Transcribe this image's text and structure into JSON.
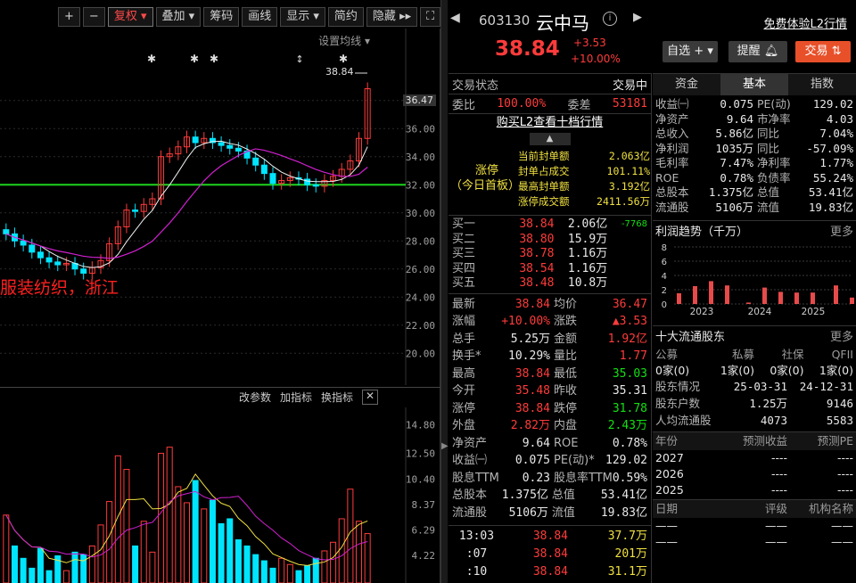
{
  "toolbar": {
    "plus": "+",
    "minus": "−",
    "fuquan": "复权",
    "overlay": "叠加",
    "chips": "筹码",
    "draw": "画线",
    "display": "显示",
    "simple": "简约",
    "hide": "隐藏"
  },
  "chart": {
    "ma_setting": "设置均线",
    "price_label": "38.84",
    "cur_price": "36.47",
    "y_ticks": [
      "38.00",
      "36.00",
      "34.00",
      "32.00",
      "30.00",
      "28.00",
      "26.00",
      "24.00",
      "22.00",
      "20.00"
    ],
    "concept": "服装纺织，浙江",
    "vol_tools": [
      "改参数",
      "加指标",
      "换指标"
    ],
    "vol_ticks": [
      "14.80",
      "12.50",
      "10.40",
      "8.37",
      "6.29",
      "4.22"
    ]
  },
  "chart_data": {
    "type": "candlestick",
    "reference_line": 32.0,
    "last_close": 38.84,
    "y_range": [
      19,
      39
    ],
    "series": [
      {
        "name": "close",
        "values": [
          28.5,
          28.0,
          27.7,
          27.2,
          26.8,
          26.5,
          26.3,
          26.4,
          26.0,
          25.7,
          26.1,
          26.6,
          27.8,
          29.0,
          30.2,
          30.1,
          30.6,
          31.0,
          34.0,
          34.2,
          34.7,
          35.4,
          35.0,
          35.3,
          35.0,
          34.8,
          34.6,
          34.4,
          33.9,
          33.4,
          32.8,
          32.1,
          32.3,
          32.5,
          32.4,
          32.0,
          31.9,
          32.3,
          32.6,
          33.1,
          33.7,
          35.3,
          38.84
        ]
      }
    ]
  },
  "stock": {
    "code": "603130",
    "name": "云中马",
    "price": "38.84",
    "change": "+3.53",
    "pct": "+10.00%",
    "free_l2": "免费体验L2行情",
    "btn_watch": "自选",
    "btn_alert": "提醒",
    "btn_trade": "交易"
  },
  "trade": {
    "status_label": "交易状态",
    "status_val": "交易中",
    "wb_label": "委比",
    "wb_val": "100.00%",
    "wc_label": "委差",
    "wc_val": "53181",
    "l2_link": "购买L2查看十档行情"
  },
  "limit": {
    "title": "涨停",
    "subtitle": "（今日首板）",
    "rows": [
      [
        "当前封单额",
        "2.063亿"
      ],
      [
        "封单占成交",
        "101.11%"
      ],
      [
        "最高封单额",
        "3.192亿"
      ],
      [
        "涨停成交额",
        "2411.56万"
      ]
    ]
  },
  "book": {
    "bids": [
      [
        "买一",
        "38.84",
        "2.06亿",
        "-7768"
      ],
      [
        "买二",
        "38.80",
        "15.9万",
        ""
      ],
      [
        "买三",
        "38.78",
        "1.16万",
        ""
      ],
      [
        "买四",
        "38.54",
        "1.16万",
        ""
      ],
      [
        "买五",
        "38.48",
        "10.8万",
        ""
      ]
    ]
  },
  "quote": [
    [
      "最新",
      "38.84",
      "均价",
      "36.47"
    ],
    [
      "涨幅",
      "+10.00%",
      "涨跌",
      "▲3.53"
    ],
    [
      "总手",
      "5.25万",
      "金额",
      "1.92亿"
    ],
    [
      "换手*",
      "10.29%",
      "量比",
      "1.77"
    ],
    [
      "最高",
      "38.84",
      "最低",
      "35.03"
    ],
    [
      "今开",
      "35.48",
      "昨收",
      "35.31"
    ],
    [
      "涨停",
      "38.84",
      "跌停",
      "31.78"
    ],
    [
      "外盘",
      "2.82万",
      "内盘",
      "2.43万"
    ],
    [
      "净资产",
      "9.64",
      "ROE",
      "0.78%"
    ],
    [
      "收益㈠",
      "0.075",
      "PE(动)*",
      "129.02"
    ],
    [
      "股息TTM",
      "0.23",
      "股息率TTM",
      "0.59%"
    ],
    [
      "总股本",
      "1.375亿",
      "总值",
      "53.41亿"
    ],
    [
      "流通股",
      "5106万",
      "流值",
      "19.83亿"
    ]
  ],
  "ticks": [
    [
      "13:03",
      "38.84",
      "37.7万"
    ],
    [
      ":07",
      "38.84",
      "201万"
    ],
    [
      ":10",
      "38.84",
      "31.1万"
    ]
  ],
  "tabs": [
    "资金",
    "基本",
    "指数"
  ],
  "fund": [
    [
      "收益㈠",
      "0.075",
      "PE(动)",
      "129.02"
    ],
    [
      "净资产",
      "9.64",
      "市净率",
      "4.03"
    ],
    [
      "总收入",
      "5.86亿",
      "同比",
      "7.04%"
    ],
    [
      "净利润",
      "1035万",
      "同比",
      "-57.09%"
    ],
    [
      "毛利率",
      "7.47%",
      "净利率",
      "1.77%"
    ],
    [
      "ROE",
      "0.78%",
      "负债率",
      "55.24%"
    ],
    [
      "总股本",
      "1.375亿",
      "总值",
      "53.41亿"
    ],
    [
      "流通股",
      "5106万",
      "流值",
      "19.83亿"
    ]
  ],
  "profit": {
    "title": "利润趋势（千万）",
    "more": "更多",
    "y_ticks": [
      "8",
      "6",
      "4",
      "2",
      "0"
    ],
    "years": [
      "2023",
      "2024",
      "2025"
    ],
    "bars": [
      1.5,
      2.5,
      3.2,
      2.6,
      0.2,
      2.3,
      1.7,
      1.6,
      1.6,
      2.6,
      0.9
    ]
  },
  "holders": {
    "title": "十大流通股东",
    "more": "更多",
    "cats": [
      "公募",
      "私募",
      "社保",
      "QFII"
    ],
    "vals": [
      "0家(0)",
      "1家(0)",
      "0家(0)",
      "1家(0)"
    ],
    "rows": [
      [
        "股东情况",
        "25-03-31",
        "24-12-31"
      ],
      [
        "股东户数",
        "1.25万",
        "9146"
      ],
      [
        "人均流通股",
        "4073",
        "5583"
      ]
    ]
  },
  "forecast": {
    "head": [
      "年份",
      "预测收益",
      "预测PE"
    ],
    "rows": [
      [
        "2027",
        "----",
        "----"
      ],
      [
        "2026",
        "----",
        "----"
      ],
      [
        "2025",
        "----",
        "----"
      ]
    ]
  },
  "rating": {
    "head": [
      "日期",
      "评级",
      "机构名称"
    ],
    "rows": [
      [
        "——",
        "——",
        "——"
      ],
      [
        "——",
        "——",
        "——"
      ]
    ]
  }
}
